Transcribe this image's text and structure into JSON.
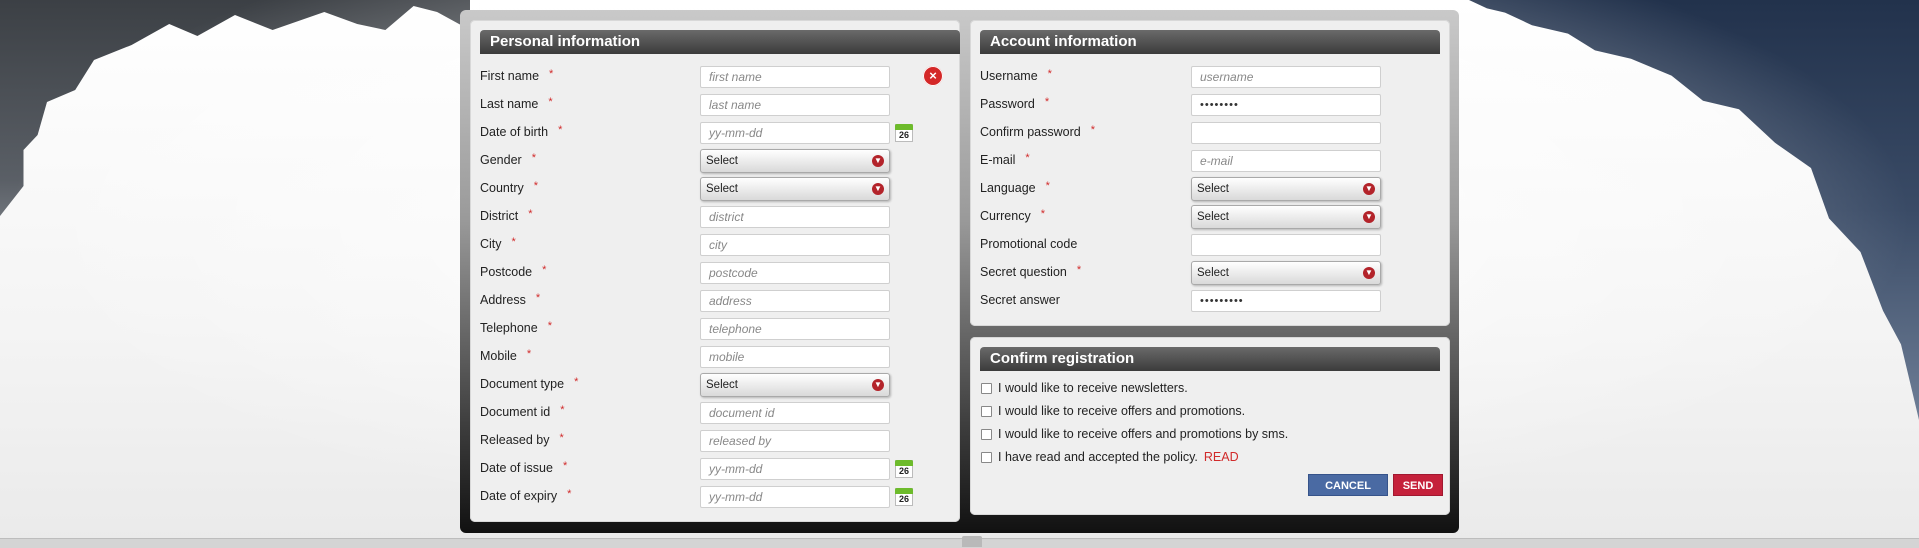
{
  "personal": {
    "title": "Personal information",
    "fields": [
      {
        "label": "First name",
        "type": "text",
        "placeholder": "first name"
      },
      {
        "label": "Last name",
        "type": "text",
        "placeholder": "last name"
      },
      {
        "label": "Date of birth",
        "type": "date",
        "placeholder": "yy-mm-dd"
      },
      {
        "label": "Gender",
        "type": "select",
        "value": "Select"
      },
      {
        "label": "Country",
        "type": "select",
        "value": "Select"
      },
      {
        "label": "District",
        "type": "text",
        "placeholder": "district"
      },
      {
        "label": "City",
        "type": "text",
        "placeholder": "city"
      },
      {
        "label": "Postcode",
        "type": "text",
        "placeholder": "postcode"
      },
      {
        "label": "Address",
        "type": "text",
        "placeholder": "address"
      },
      {
        "label": "Telephone",
        "type": "text",
        "placeholder": "telephone"
      },
      {
        "label": "Mobile",
        "type": "text",
        "placeholder": "mobile"
      },
      {
        "label": "Document type",
        "type": "select",
        "value": "Select"
      },
      {
        "label": "Document id",
        "type": "text",
        "placeholder": "document id"
      },
      {
        "label": "Released by",
        "type": "text",
        "placeholder": "released by"
      },
      {
        "label": "Date of issue",
        "type": "date",
        "placeholder": "yy-mm-dd"
      },
      {
        "label": "Date of expiry",
        "type": "date",
        "placeholder": "yy-mm-dd"
      }
    ],
    "required_mark": "*",
    "calendar_day": "26",
    "close_icon": "×"
  },
  "account": {
    "title": "Account information",
    "fields": [
      {
        "label": "Username",
        "type": "text",
        "placeholder": "username",
        "required": true
      },
      {
        "label": "Password",
        "type": "masked",
        "value": "••••••••",
        "required": true
      },
      {
        "label": "Confirm password",
        "type": "masked",
        "value": "",
        "required": true
      },
      {
        "label": "E-mail",
        "type": "text",
        "placeholder": "e-mail",
        "required": true
      },
      {
        "label": "Language",
        "type": "select",
        "value": "Select",
        "required": true
      },
      {
        "label": "Currency",
        "type": "select",
        "value": "Select",
        "required": true
      },
      {
        "label": "Promotional code",
        "type": "masked",
        "value": "",
        "required": false
      },
      {
        "label": "Secret question",
        "type": "select",
        "value": "Select",
        "required": true
      },
      {
        "label": "Secret answer",
        "type": "masked",
        "value": "•••••••••",
        "required": false
      }
    ]
  },
  "confirm": {
    "title": "Confirm registration",
    "options": [
      {
        "label": "I would like to receive newsletters."
      },
      {
        "label": "I would like to receive offers and promotions."
      },
      {
        "label": "I would like to receive offers and promotions by sms."
      },
      {
        "label": "I have read and accepted the policy.",
        "link": "READ"
      }
    ],
    "cancel_label": "CANCEL",
    "send_label": "SEND"
  },
  "colors": {
    "accent_red": "#c5213b",
    "cancel_blue": "#4a6aa3",
    "calendar_green": "#6dbb2b",
    "title_bar": "#3b3b3b"
  },
  "icons": {
    "close": "close-icon",
    "calendar": "calendar-icon",
    "dropdown": "chevron-down-icon"
  }
}
